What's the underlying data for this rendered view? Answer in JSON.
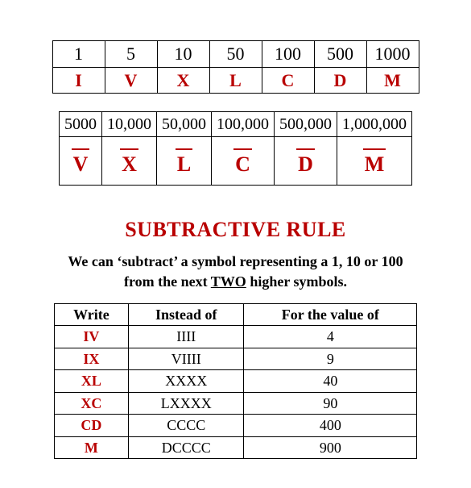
{
  "basic_table": {
    "arabic": [
      "1",
      "5",
      "10",
      "50",
      "100",
      "500",
      "1000"
    ],
    "roman": [
      "I",
      "V",
      "X",
      "L",
      "C",
      "D",
      "M"
    ]
  },
  "large_table": {
    "arabic": [
      "5000",
      "10,000",
      "50,000",
      "100,000",
      "500,000",
      "1,000,000"
    ],
    "roman": [
      "V",
      "X",
      "L",
      "C",
      "D",
      "M"
    ]
  },
  "heading": "SUBTRACTIVE RULE",
  "lead": {
    "pre": "We can ‘subtract’ a symbol representing a 1, 10 or 100 from the next ",
    "two": "TWO",
    "post": " higher symbols."
  },
  "sub_table": {
    "headers": [
      "Write",
      "Instead of",
      "For the value of"
    ],
    "rows": [
      {
        "write": "IV",
        "instead": "IIII",
        "value": "4"
      },
      {
        "write": "IX",
        "instead": "VIIII",
        "value": "9"
      },
      {
        "write": "XL",
        "instead": "XXXX",
        "value": "40"
      },
      {
        "write": "XC",
        "instead": "LXXXX",
        "value": "90"
      },
      {
        "write": "CD",
        "instead": "CCCC",
        "value": "400"
      },
      {
        "write": "M",
        "instead": "DCCCC",
        "value": "900"
      }
    ]
  }
}
